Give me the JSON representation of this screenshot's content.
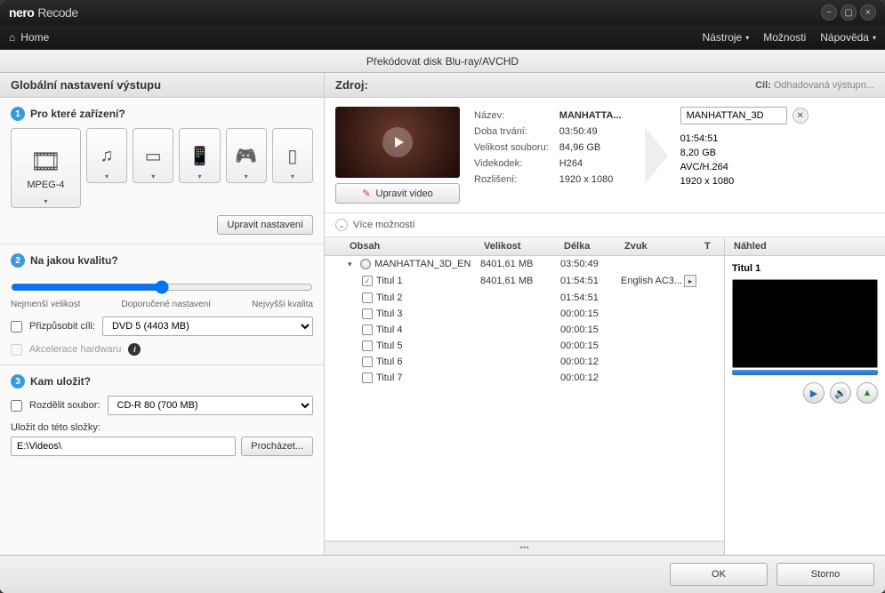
{
  "app": {
    "brand": "nero",
    "product": "Recode"
  },
  "window_buttons": {
    "min": "−",
    "max": "▢",
    "close": "×"
  },
  "menubar": {
    "home": "Home",
    "tools": "Nástroje",
    "options": "Možnosti",
    "help": "Nápověda"
  },
  "toolbar": {
    "title": "Překódovat disk Blu-ray/AVCHD"
  },
  "left": {
    "title": "Globální nastavení výstupu",
    "s1": {
      "num": "1",
      "heading": "Pro které zařízení?",
      "selected_label": "MPEG-4",
      "edit_settings": "Upravit nastavení"
    },
    "s2": {
      "num": "2",
      "heading": "Na jakou kvalitu?",
      "min": "Nejmenší velikost",
      "rec": "Doporučené nastavení",
      "max": "Nejvyšší kvalita",
      "fit_label": "Přizpůsobit cíli:",
      "fit_value": "DVD 5    (4403 MB)",
      "hw_accel": "Akcelerace hardwaru"
    },
    "s3": {
      "num": "3",
      "heading": "Kam uložit?",
      "split_label": "Rozdělit soubor:",
      "split_value": "CD-R 80 (700 MB)",
      "save_to": "Uložit do této složky:",
      "path": "E:\\Videos\\",
      "browse": "Procházet..."
    }
  },
  "source": {
    "heading": "Zdroj:",
    "target_label": "Cíl:",
    "target_hint": "Odhadovaná výstupn...",
    "edit_video": "Upravit video",
    "labels": {
      "name": "Název:",
      "duration": "Doba trvání:",
      "filesize": "Velikost souboru:",
      "vcodec": "Videkodek:",
      "res": "Rozlišení:"
    },
    "src": {
      "name": "MANHATTA...",
      "duration": "03:50:49",
      "filesize": "84,96 GB",
      "vcodec": "H264",
      "res": "1920 x 1080"
    },
    "dst": {
      "name": "MANHATTAN_3D",
      "duration": "01:54:51",
      "filesize": "8,20 GB",
      "vcodec": "AVC/H.264",
      "res": "1920 x 1080"
    },
    "more": "Více možností"
  },
  "tree": {
    "headers": {
      "content": "Obsah",
      "size": "Velikost",
      "length": "Délka",
      "audio": "Zvuk",
      "t": "T"
    },
    "root": {
      "name": "MANHATTAN_3D_EN",
      "size": "8401,61 MB",
      "length": "03:50:49"
    },
    "items": [
      {
        "name": "Titul 1",
        "size": "8401,61 MB",
        "length": "01:54:51",
        "audio": "English AC3...",
        "checked": true
      },
      {
        "name": "Titul 2",
        "size": "",
        "length": "01:54:51",
        "audio": "",
        "checked": false
      },
      {
        "name": "Titul 3",
        "size": "",
        "length": "00:00:15",
        "audio": "",
        "checked": false
      },
      {
        "name": "Titul 4",
        "size": "",
        "length": "00:00:15",
        "audio": "",
        "checked": false
      },
      {
        "name": "Titul 5",
        "size": "",
        "length": "00:00:15",
        "audio": "",
        "checked": false
      },
      {
        "name": "Titul 6",
        "size": "",
        "length": "00:00:12",
        "audio": "",
        "checked": false
      },
      {
        "name": "Titul 7",
        "size": "",
        "length": "00:00:12",
        "audio": "",
        "checked": false
      }
    ]
  },
  "preview": {
    "heading": "Náhled",
    "title": "Titul 1"
  },
  "footer": {
    "ok": "OK",
    "cancel": "Storno"
  }
}
